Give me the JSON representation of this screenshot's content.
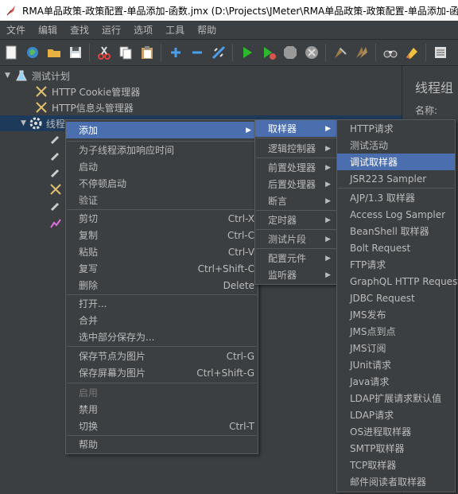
{
  "window": {
    "title": "RMA单品政策-政策配置-单品添加-函数.jmx (D:\\Projects\\JMeter\\RMA单品政策-政策配置-单品添加-函数.jmx) - Apache JMeter"
  },
  "menubar": [
    "文件",
    "编辑",
    "查找",
    "运行",
    "选项",
    "工具",
    "帮助"
  ],
  "toolbar": [
    "new-icon",
    "templates-icon",
    "open-icon",
    "save-icon",
    "cut-icon",
    "copy-icon",
    "paste-icon",
    "expand-icon",
    "collapse-icon",
    "toggle-icon",
    "start-icon",
    "start-no-pause-icon",
    "stop-icon",
    "shutdown-icon",
    "clear-icon",
    "clear-all-icon",
    "search-icon",
    "reset-search-icon",
    "function-helper-icon"
  ],
  "tree": {
    "test_plan": "测试计划",
    "cookie_manager": "HTTP Cookie管理器",
    "header_manager": "HTTP信息头管理器",
    "thread_group": "线程组"
  },
  "right_panel": {
    "title": "线程组",
    "name_label": "名称:"
  },
  "context_menu": {
    "add": "添加",
    "add_think_time": "为子线程添加响应时间",
    "start": "启动",
    "start_no_pause": "不停顿启动",
    "validate": "验证",
    "cut": "剪切",
    "cut_sc": "Ctrl-X",
    "copy": "复制",
    "copy_sc": "Ctrl-C",
    "paste": "粘贴",
    "paste_sc": "Ctrl-V",
    "overwrite": "复写",
    "overwrite_sc": "Ctrl+Shift-C",
    "delete": "删除",
    "delete_sc": "Delete",
    "open": "打开...",
    "merge": "合并",
    "save_selection": "选中部分保存为...",
    "save_node_image": "保存节点为图片",
    "save_node_image_sc": "Ctrl-G",
    "save_screen_image": "保存屏幕为图片",
    "save_screen_image_sc": "Ctrl+Shift-G",
    "enable": "启用",
    "disable": "禁用",
    "toggle": "切换",
    "toggle_sc": "Ctrl-T",
    "help": "帮助"
  },
  "add_submenu": {
    "sampler": "取样器",
    "logic_controller": "逻辑控制器",
    "pre_processor": "前置处理器",
    "post_processor": "后置处理器",
    "assertion": "断言",
    "timer": "定时器",
    "test_fragment": "测试片段",
    "config_element": "配置元件",
    "listener": "监听器"
  },
  "sampler_submenu": [
    "HTTP请求",
    "测试活动",
    "调试取样器",
    "JSR223 Sampler",
    "AJP/1.3 取样器",
    "Access Log Sampler",
    "BeanShell 取样器",
    "Bolt Request",
    "FTP请求",
    "GraphQL HTTP Request",
    "JDBC Request",
    "JMS发布",
    "JMS点到点",
    "JMS订阅",
    "JUnit请求",
    "Java请求",
    "LDAP扩展请求默认值",
    "LDAP请求",
    "OS进程取样器",
    "SMTP取样器",
    "TCP取样器",
    "邮件阅读者取样器"
  ],
  "colors": {
    "background": "#3c3f41",
    "highlight": "#4b6eaf",
    "selection": "#1e3a5a"
  }
}
